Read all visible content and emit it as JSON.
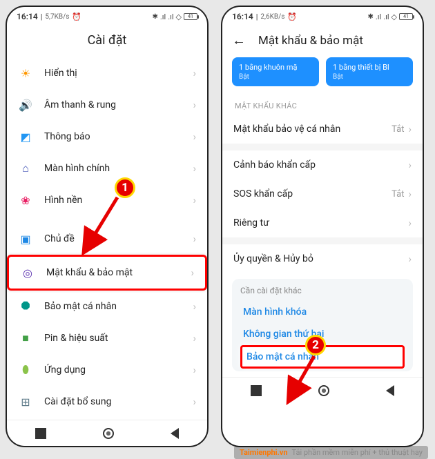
{
  "status": {
    "time": "16:14",
    "net1": "5,7KB/s",
    "net2": "2,6KB/s",
    "alarm": "⏰",
    "bt": "✱",
    "sig": "▮▮▮▮",
    "wifi": "⬙",
    "batt": "41"
  },
  "p1": {
    "title": "Cài đặt",
    "rows": [
      {
        "icon": "☀",
        "cls": "c-orange",
        "label": "Hiển thị"
      },
      {
        "icon": "🔊",
        "cls": "c-green",
        "label": "Âm thanh & rung"
      },
      {
        "icon": "◩",
        "cls": "c-blue",
        "label": "Thông báo"
      },
      {
        "icon": "⌂",
        "cls": "c-blue2",
        "label": "Màn hình chính"
      },
      {
        "icon": "❀",
        "cls": "c-pink",
        "label": "Hình nền"
      },
      {
        "icon": "▣",
        "cls": "c-cyan",
        "label": "Chủ đề"
      },
      {
        "icon": "◎",
        "cls": "c-indigo",
        "label": "Mật khẩu & bảo mật",
        "hl": true
      },
      {
        "icon": "⯃",
        "cls": "c-teal",
        "label": "Bảo mật cá nhân"
      },
      {
        "icon": "■",
        "cls": "c-dgreen",
        "label": "Pin & hiệu suất"
      },
      {
        "icon": "⬮",
        "cls": "c-lime",
        "label": "Ứng dụng"
      },
      {
        "icon": "⊞",
        "cls": "c-greyblue",
        "label": "Cài đặt bổ sung"
      }
    ]
  },
  "p2": {
    "title": "Mật khẩu & bảo mật",
    "cards": [
      {
        "t": "1 bằng khuôn mặ",
        "s": "Bật"
      },
      {
        "t": "1 bằng thiết bị Bl",
        "s": "Bật"
      }
    ],
    "sectHeader": "MẬT KHẨU KHÁC",
    "rows1": [
      {
        "label": "Mật khẩu bảo vệ cá nhân",
        "val": "Tắt"
      }
    ],
    "rows2": [
      {
        "label": "Cảnh báo khẩn cấp"
      },
      {
        "label": "SOS khẩn cấp",
        "val": "Tắt"
      },
      {
        "label": "Riêng tư"
      }
    ],
    "rows3": [
      {
        "label": "Ủy quyền & Hủy bỏ"
      }
    ],
    "more": {
      "hdr": "Cần cài đặt khác",
      "links": [
        {
          "t": "Màn hình khóa"
        },
        {
          "t": "Không gian thứ hai"
        },
        {
          "t": "Bảo mật cá nhân",
          "sel": true
        }
      ]
    }
  },
  "annot": {
    "n1": "1",
    "n2": "2"
  },
  "wm": {
    "logo": "Taimienphi.vn",
    "txt": "Tải phần mềm miễn phí + thủ thuật hay"
  }
}
